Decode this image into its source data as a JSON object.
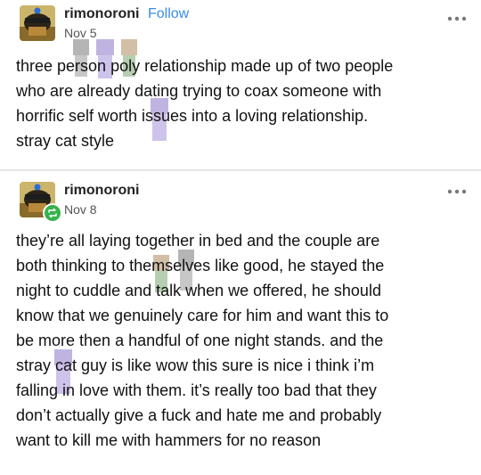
{
  "posts": [
    {
      "username": "rimonoroni",
      "follow_label": "Follow",
      "date": "Nov 5",
      "more_icon": "ellipsis-icon",
      "body_lines": [
        "three person poly relationship made up of two people",
        "who are already dating trying to coax someone with",
        "horrific self worth issues into a loving relationship.",
        "stray cat style"
      ]
    },
    {
      "username": "rimonoroni",
      "date": "Nov 8",
      "more_icon": "ellipsis-icon",
      "reblog_icon": "reblog-icon",
      "body_lines": [
        "they’re all laying together in bed and the couple are",
        "both thinking to themselves like good, he stayed the",
        "night to cuddle and talk when we offered, he should",
        "know that we genuinely care for him and want this to",
        "be more then a handful of one night stands. and the",
        "stray cat guy is like wow this sure is nice i think i’m",
        "falling in love with them. it’s really too bad that they",
        "don’t actually give a fuck and hate me and probably",
        "want to kill me with hammers for no reason"
      ]
    }
  ],
  "colors": {
    "follow": "#3b8be8",
    "reblog_badge": "#37b24d",
    "divider": "#e6e6e6",
    "text": "#111111"
  }
}
